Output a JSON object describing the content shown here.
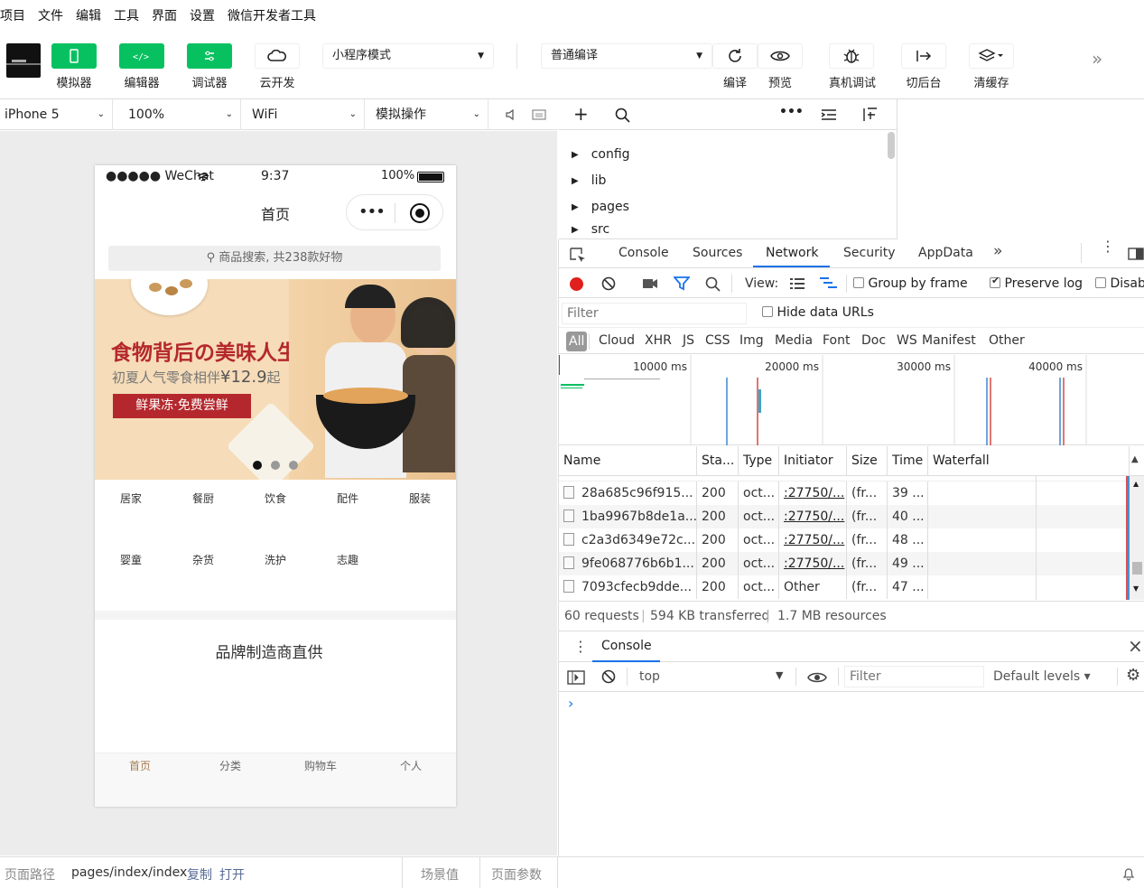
{
  "menubar": [
    "项目",
    "文件",
    "编辑",
    "工具",
    "界面",
    "设置",
    "微信开发者工具"
  ],
  "toolbar": {
    "simulator_label": "模拟器",
    "editor_label": "编辑器",
    "debugger_label": "调试器",
    "cloud_label": "云开发",
    "mode_select": "小程序模式",
    "compile_select": "普通编译",
    "compile_label": "编译",
    "preview_label": "预览",
    "remote_debug_label": "真机调试",
    "background_label": "切后台",
    "clear_cache_label": "清缓存",
    "accent_color": "#07c160"
  },
  "devicebar": {
    "device": "iPhone 5",
    "zoom": "100%",
    "network": "WiFi",
    "simulate": "模拟操作"
  },
  "phone": {
    "status_carrier": "●●●●● WeChat",
    "status_time": "9:37",
    "status_battery": "100%",
    "nav_title": "首页",
    "search_placeholder": "商品搜索, 共238款好物",
    "banner_title": "食物背后の美味人生",
    "banner_subtitle_prefix": "初夏人气零食相伴",
    "banner_price": "¥12.9",
    "banner_subtitle_suffix": "起",
    "banner_button": "鲜果冻·免费尝鲜",
    "banner_dots": 3,
    "banner_active_dot": 0,
    "categories": [
      "居家",
      "餐厨",
      "饮食",
      "配件",
      "服装",
      "婴童",
      "杂货",
      "洗护",
      "志趣"
    ],
    "brand_section_title": "品牌制造商直供",
    "tabs": [
      "首页",
      "分类",
      "购物车",
      "个人"
    ],
    "active_tab": "首页",
    "active_color": "#b4282d"
  },
  "filetree": {
    "items": [
      "config",
      "lib",
      "pages",
      "src"
    ]
  },
  "devtools": {
    "tabs": [
      "Console",
      "Sources",
      "Network",
      "Security",
      "AppData"
    ],
    "active_tab": "Network",
    "view_label": "View:",
    "group_by_frame": "Group by frame",
    "preserve_log": "Preserve log",
    "disable_cache": "Disab",
    "filter_placeholder": "Filter",
    "hide_data_urls": "Hide data URLs",
    "types": [
      "All",
      "Cloud",
      "XHR",
      "JS",
      "CSS",
      "Img",
      "Media",
      "Font",
      "Doc",
      "WS",
      "Manifest",
      "Other"
    ],
    "active_type": "All",
    "timeline_ticks": [
      "10000 ms",
      "20000 ms",
      "30000 ms",
      "40000 ms"
    ],
    "columns": [
      "Name",
      "Sta...",
      "Type",
      "Initiator",
      "Size",
      "Time",
      "Waterfall"
    ],
    "rows": [
      {
        "name": "28a685c96f915...",
        "status": "200",
        "type": "oct...",
        "initiator": ":27750/...",
        "size": "(fr...",
        "time": "39 ..."
      },
      {
        "name": "1ba9967b8de1a...",
        "status": "200",
        "type": "oct...",
        "initiator": ":27750/...",
        "size": "(fr...",
        "time": "40 ..."
      },
      {
        "name": "c2a3d6349e72c...",
        "status": "200",
        "type": "oct...",
        "initiator": ":27750/...",
        "size": "(fr...",
        "time": "48 ..."
      },
      {
        "name": "9fe068776b6b1...",
        "status": "200",
        "type": "oct...",
        "initiator": ":27750/...",
        "size": "(fr...",
        "time": "49 ..."
      },
      {
        "name": "7093cfecb9dde...",
        "status": "200",
        "type": "oct...",
        "initiator": "Other",
        "size": "(fr...",
        "time": "47 ..."
      }
    ],
    "summary_requests": "60 requests",
    "summary_transferred": "594 KB transferred",
    "summary_resources": "1.7 MB resources",
    "drawer_tab": "Console",
    "console_context": "top",
    "console_filter": "Filter",
    "console_levels": "Default levels ▾",
    "console_prompt": "›",
    "record_color": "#e0201e",
    "active_blue": "#1a73e8"
  },
  "bottombar": {
    "path_label": "页面路径",
    "path": "pages/index/index",
    "copy": "复制",
    "open": "打开",
    "scene": "场景值",
    "params": "页面参数"
  }
}
